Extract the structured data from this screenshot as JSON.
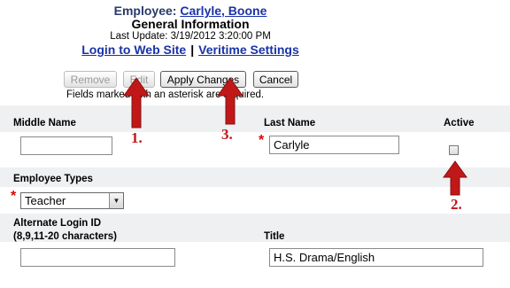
{
  "header": {
    "employee_label": "Employee:",
    "employee_name": "Carlyle, Boone",
    "section_title": "General Information",
    "last_update": "Last Update: 3/19/2012 3:20:00 PM",
    "login_link": "Login to Web Site",
    "separator": "|",
    "veritime_link": "Veritime Settings"
  },
  "toolbar": {
    "remove_label": "Remove",
    "edit_label": "Edit",
    "apply_label": "Apply Changes",
    "cancel_label": "Cancel"
  },
  "required_note": "Fields marked with an asterisk are required.",
  "form": {
    "middle_name": {
      "label": "Middle Name",
      "value": ""
    },
    "last_name": {
      "label": "Last Name",
      "value": "Carlyle",
      "required_mark": "*"
    },
    "active": {
      "label": "Active",
      "checked": false
    },
    "employee_types": {
      "label": "Employee Types",
      "value": "Teacher",
      "required_mark": "*"
    },
    "alternate_login": {
      "label_line1": "Alternate Login ID",
      "label_line2": "(8,9,11-20 characters)",
      "value": ""
    },
    "title": {
      "label": "Title",
      "value": "H.S. Drama/English"
    }
  },
  "annotations": {
    "n1": "1.",
    "n2": "2.",
    "n3": "3.",
    "color": "#c01818"
  }
}
